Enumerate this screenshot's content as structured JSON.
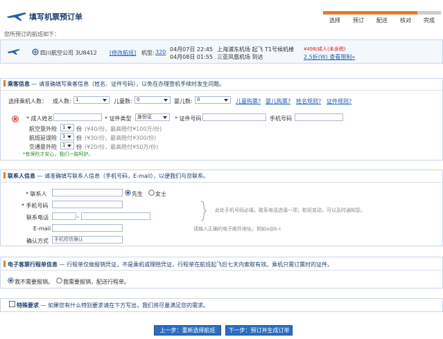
{
  "header": {
    "title": "填写机票预订单",
    "subtitle": "您所预订的航班如下：",
    "steps": [
      "选择",
      "预订",
      "配送",
      "核对",
      "完成"
    ],
    "step_colors": [
      "#e9792b",
      "#e9792b",
      "#e9792b",
      "#e9792b",
      "#cccccc"
    ]
  },
  "flight": {
    "airline": "四川航空公司 3U8412",
    "change_flight": "[修改航班]",
    "aircraft_label": "机型:",
    "aircraft": "320",
    "depart_time": "04月07日 22:45",
    "depart_place": "上海浦东机场 起飞 T1号候机楼",
    "arrive_time": "04月08日 01:55",
    "arrive_place": "三亚凤凰机场 到达",
    "price": "¥498/成人(未含税)",
    "discount": "2.5折(W) 查看限制»"
  },
  "passenger": {
    "title": "乘客信息",
    "desc": " — 请准确填写乘客信息（姓名、证件号码），以免在办理登机手续时发生问题。",
    "select_label": "选择乘机人数：",
    "adult_label": "成人数:",
    "adult_val": "1",
    "child_label": "儿童数:",
    "child_val": "0",
    "infant_label": "婴儿数:",
    "infant_val": "0",
    "links": [
      "儿童购票?",
      "婴儿购票?",
      "姓名规则?",
      "证件规则?"
    ],
    "name_label": "* 成人姓名",
    "idtype_label": "* 证件类型",
    "idtype_val": "身份证",
    "idno_label": "* 证件号码",
    "phone_label": "手机号码",
    "ins1_label": "航空意外险",
    "ins1_val": "1",
    "ins1_unit": "份",
    "ins1_note": "(¥40/份，最高赔付¥100万/份)",
    "ins2_label": "航班延误险",
    "ins2_val": "1",
    "ins2_unit": "份",
    "ins2_note": "(¥30/份，最高赔付¥300/份)",
    "ins3_label": "交通意外险",
    "ins3_val": "1",
    "ins3_unit": "份",
    "ins3_note": "(¥20/份，最高赔付¥50万/份)",
    "ins_tip": "*有保险才安心，我们一路呵护。"
  },
  "contact": {
    "title": "联系人信息",
    "desc": " — 请准确填写联系人信息（手机号码，E-mail），以便我们与您联系。",
    "name_label": "* 联系人",
    "mr": "先生",
    "ms": "女士",
    "mobile_label": "* 手机号码",
    "tel_label": "联系电话",
    "email_label": "E-mail",
    "confirm_label": "确认方式",
    "confirm_val": "手机短信确认",
    "note1": "此处手机号码必填。联系电话选填一项；航班变动，可以及时通知您。",
    "note2": "请输入正确的电子邮件地址，例如a@b.c"
  },
  "itinerary": {
    "title": "电子客票行程单信息",
    "desc": " — 行程单仅做报销凭证，不是乘机或理赔凭证，行程单在航班起飞后七天内索取有效。乘机只需订票时的证件。",
    "opt1": "我不需要报销。",
    "opt2": "我需要报销，配送行程单。"
  },
  "special": {
    "title": "特殊要求",
    "desc": " — 如果您有什么特别要求请在下方写出，我们将尽量满足您的需求。"
  },
  "buttons": {
    "prev": "上一步：重新选择航班",
    "next": "下一步：预订并生成订单"
  }
}
